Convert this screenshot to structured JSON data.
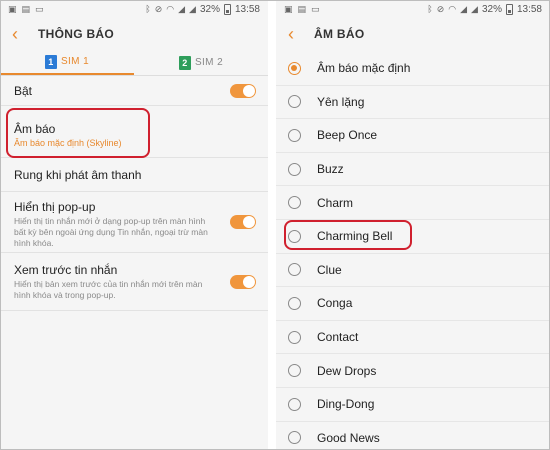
{
  "status": {
    "battery": "32%",
    "time": "13:58"
  },
  "left": {
    "header_title": "THÔNG BÁO",
    "tabs": [
      {
        "number": "1",
        "label": "SIM 1"
      },
      {
        "number": "2",
        "label": "SIM 2"
      }
    ],
    "settings": {
      "bat": {
        "title": "Bật"
      },
      "am_bao": {
        "title": "Âm báo",
        "value": "Âm báo mặc định (Skyline)"
      },
      "rung": {
        "title": "Rung khi phát âm thanh"
      },
      "hien_thi": {
        "title": "Hiển thị pop-up",
        "desc": "Hiển thị tin nhắn mới ở dạng pop-up trên màn hình bất kỳ bên ngoài ứng dụng Tin nhắn, ngoại trừ màn hình khóa."
      },
      "xem_truoc": {
        "title": "Xem trước tin nhắn",
        "desc": "Hiển thị bản xem trước của tin nhắn mới trên màn hình khóa và trong pop-up."
      }
    }
  },
  "right": {
    "header_title": "ÂM BÁO",
    "selected": "Âm báo mặc định",
    "options": [
      "Âm báo mặc định",
      "Yên lặng",
      "Beep Once",
      "Buzz",
      "Charm",
      "Charming Bell",
      "Clue",
      "Conga",
      "Contact",
      "Dew Drops",
      "Ding-Dong",
      "Good News"
    ]
  },
  "colors": {
    "accent": "#e8892e",
    "toggle_on": "#f0963d",
    "highlight": "#d0202e",
    "sim1": "#2b7bd6",
    "sim2": "#2e9e5b"
  }
}
